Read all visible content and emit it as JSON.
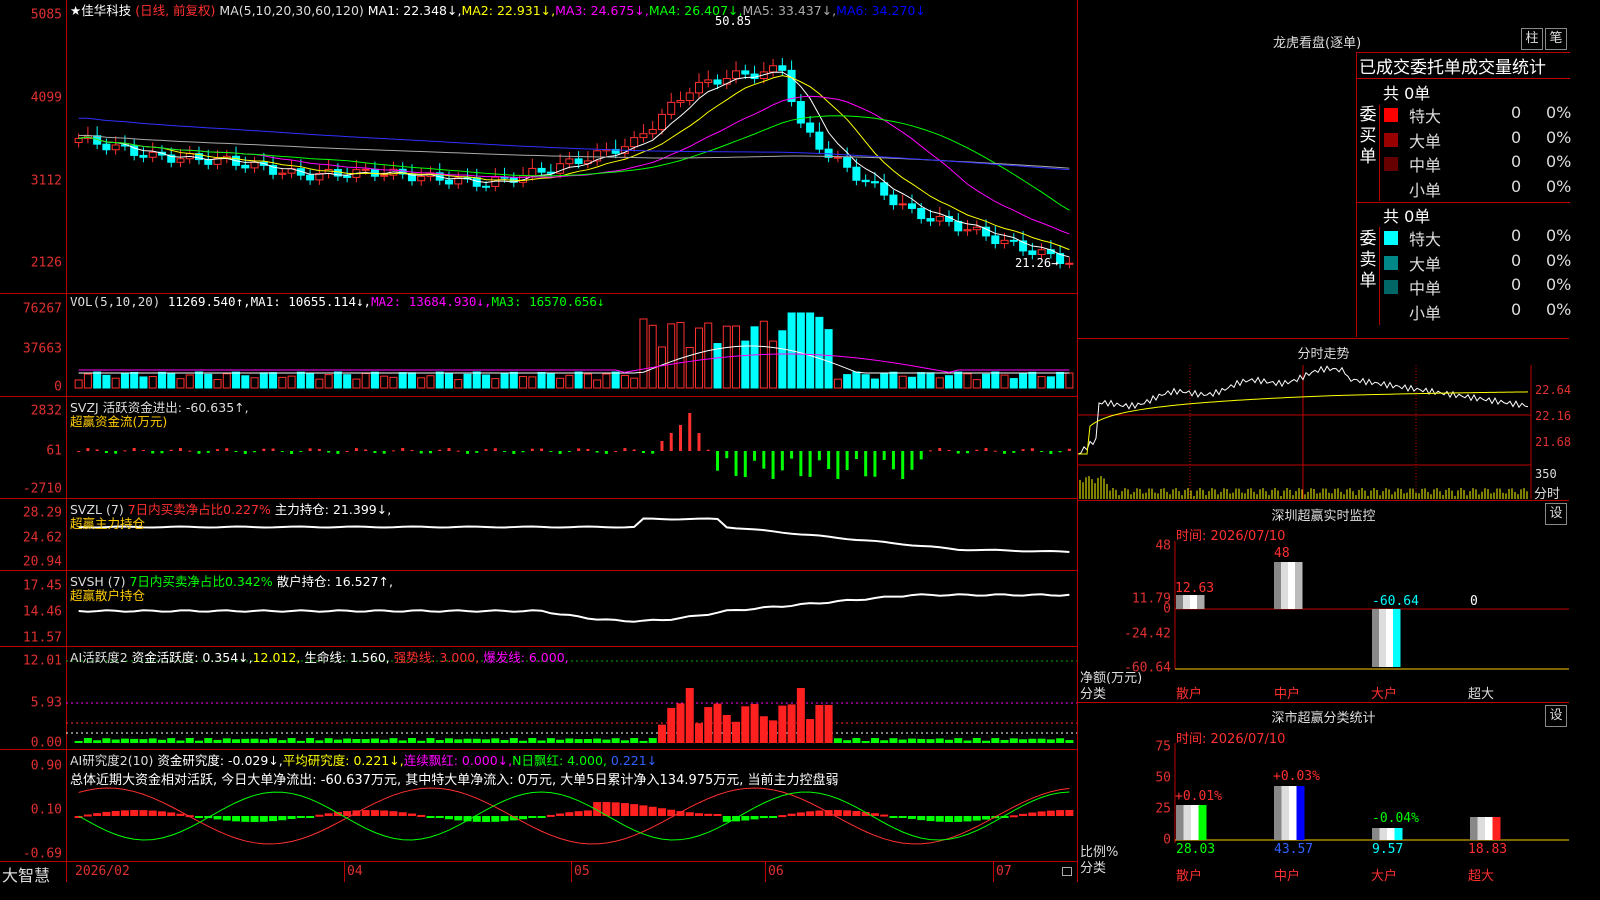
{
  "main": {
    "title": "佳华科技",
    "period": "(日线, 前复权)",
    "ma_def": "MA(5,10,20,30,60,120)",
    "ma": [
      {
        "text": "MA1: 22.348↓,",
        "color": "#ffffff"
      },
      {
        "text": "MA2: 22.931↓,",
        "color": "#ffff00"
      },
      {
        "text": "MA3: 24.675↓,",
        "color": "#ff00ff"
      },
      {
        "text": "MA4: 26.407↓,",
        "color": "#00ff00"
      },
      {
        "text": "MA5: 33.437↓,",
        "color": "#aaaaaa"
      },
      {
        "text": "MA6: 34.270↓",
        "color": "#0000ff"
      }
    ],
    "y_ticks": [
      "5085",
      "4099",
      "3112",
      "2126"
    ],
    "high_label": "50.85",
    "low_label": "21.26→"
  },
  "vol": {
    "header": "VOL(5,10,20)",
    "value": "11269.540↑,",
    "ma1": "MA1: 10655.114↓,",
    "ma2": "MA2: 13684.930↓,",
    "ma3": "MA3: 16570.656↓",
    "y_ticks": [
      "76267",
      "37663",
      "0"
    ]
  },
  "svzj": {
    "header": "SVZJ  活跃资金进出: -60.635↑,",
    "subtitle": "超赢资金流(万元)",
    "y_ticks": [
      "2832",
      "61",
      "-2710"
    ]
  },
  "svzl": {
    "header": "SVZL (7)",
    "ratio": "7日内买卖净占比0.227%",
    "hold": "主力持仓: 21.399↓,",
    "subtitle": "超赢主力持仓",
    "y_ticks": [
      "28.29",
      "24.62",
      "20.94"
    ]
  },
  "svsh": {
    "header": "SVSH (7)",
    "ratio": "7日内买卖净占比0.342%",
    "hold": "散户持仓: 16.527↑,",
    "subtitle": "超赢散户持仓",
    "y_ticks": [
      "17.45",
      "14.46",
      "11.57"
    ]
  },
  "ai1": {
    "header": "AI活跃度2",
    "v1": "资金活跃度: 0.354↓,",
    "v2": "12.012,",
    "v3": "生命线: 1.560,",
    "v4": "强势线: 3.000,",
    "v5": "爆发线: 6.000,",
    "y_ticks": [
      "12.01",
      "5.93",
      "0.00"
    ]
  },
  "ai2": {
    "header": "AI研究度2(10)",
    "v1": "资金研究度: -0.029↓,",
    "v2": "平均研究度: 0.221↓,",
    "v3": "连续飘红: 0.000↓,",
    "v4": "N日飘红: 4.000,",
    "v5": "0.221↓",
    "summary": "总体近期大资金相对活跃, 今日大单净流出: -60.637万元, 其中特大单净流入: 0万元, 大单5日累计净入134.975万元, 当前主力控盘弱",
    "y_ticks": [
      "0.90",
      "0.10",
      "-0.69"
    ]
  },
  "date_axis": [
    "2026/02",
    "04",
    "05",
    "06",
    "07"
  ],
  "brand": "大智慧",
  "lhb": {
    "title": "龙虎看盘(逐单)",
    "btn1": "柱",
    "btn2": "笔",
    "tab_title": "已成交委托单成交量统计",
    "buy": {
      "side": "委买单",
      "total": "共 0单",
      "rows": [
        {
          "label": "特大",
          "value": "0",
          "pct": "0%",
          "color": "#ff0000"
        },
        {
          "label": "大单",
          "value": "0",
          "pct": "0%",
          "color": "#990000"
        },
        {
          "label": "中单",
          "value": "0",
          "pct": "0%",
          "color": "#660000"
        },
        {
          "label": "小单",
          "value": "0",
          "pct": "0%",
          "color": ""
        }
      ]
    },
    "sell": {
      "side": "委卖单",
      "total": "共 0单",
      "rows": [
        {
          "label": "特大",
          "value": "0",
          "pct": "0%",
          "color": "#00ffff"
        },
        {
          "label": "大单",
          "value": "0",
          "pct": "0%",
          "color": "#008888"
        },
        {
          "label": "中单",
          "value": "0",
          "pct": "0%",
          "color": "#006666"
        },
        {
          "label": "小单",
          "value": "0",
          "pct": "0%",
          "color": ""
        }
      ]
    }
  },
  "fenshi": {
    "title": "分时走势",
    "y_ticks": [
      "22.64",
      "22.16",
      "21.68"
    ],
    "vol_label": "350",
    "unit": "分时"
  },
  "monitor": {
    "title": "深圳超赢实时监控",
    "btn": "设",
    "time": "时间: 2026/07/10",
    "y_ticks": [
      "48",
      "11.79",
      "0",
      "-24.42",
      "-60.64"
    ],
    "y_label": "净额(万元)",
    "x_label": "分类",
    "bar_labels": [
      "12.63",
      "48",
      "-60.64",
      "0"
    ]
  },
  "classify": {
    "title": "深市超赢分类统计",
    "btn": "设",
    "time": "时间: 2026/07/10",
    "y_ticks": [
      "75",
      "50",
      "25",
      "0"
    ],
    "y_label": "比例%",
    "x_label": "分类",
    "bar_top": [
      "+0.01%",
      "+0.03%",
      "-0.04%"
    ],
    "bar_values": [
      "28.03",
      "43.57",
      "9.57",
      "18.83"
    ]
  },
  "categories": [
    "散户",
    "中户",
    "大户",
    "超大"
  ],
  "chart_data": {
    "type": "candlestick",
    "title": "佳华科技 (日线, 前复权)",
    "y_ticks": [
      5085,
      4099,
      3112,
      2126
    ],
    "high": 50.85,
    "low": 21.26,
    "x_ticks": [
      "2026/02",
      "04",
      "05",
      "06",
      "07"
    ],
    "series": [
      {
        "name": "MA1",
        "last": 22.348
      },
      {
        "name": "MA2",
        "last": 22.931
      },
      {
        "name": "MA3",
        "last": 24.675
      },
      {
        "name": "MA4",
        "last": 26.407
      },
      {
        "name": "MA5",
        "last": 33.437
      },
      {
        "name": "MA6",
        "last": 34.27
      }
    ]
  }
}
